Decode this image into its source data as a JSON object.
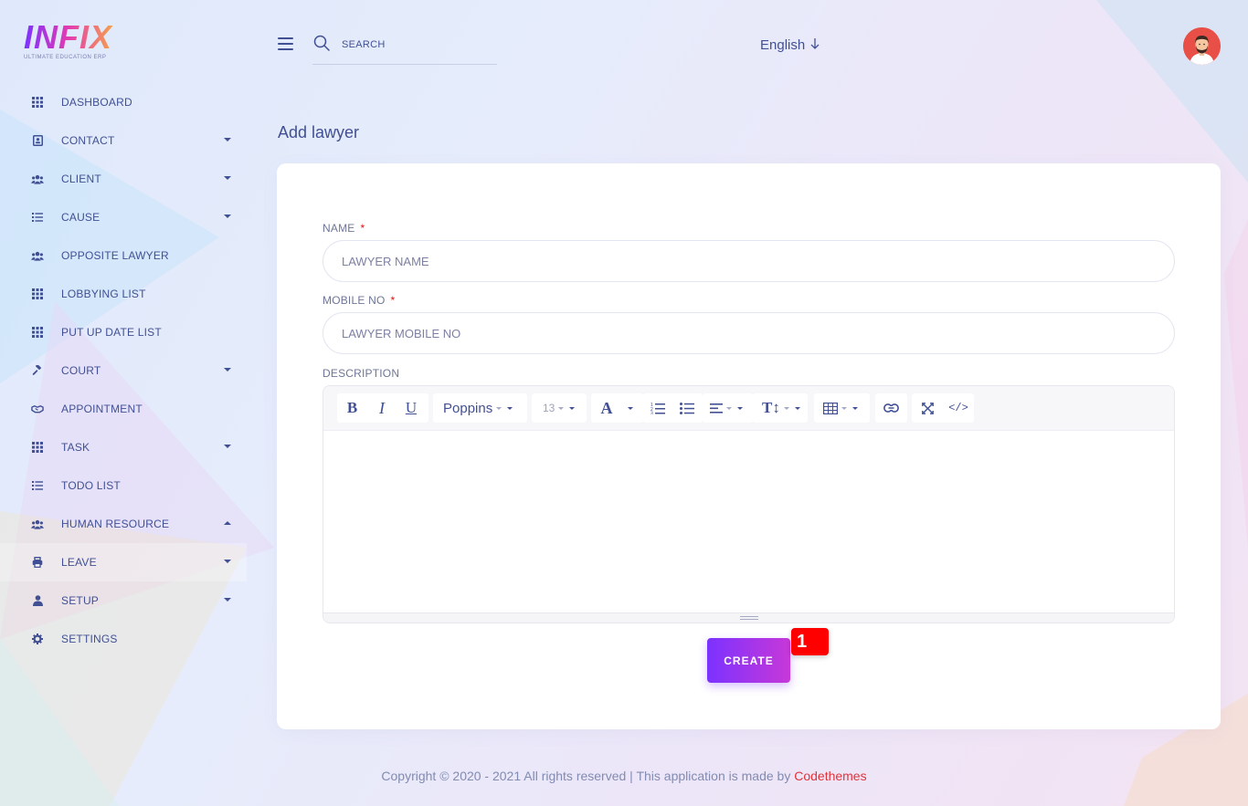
{
  "brand": {
    "logo_text": "INFIX",
    "logo_subtitle": "ULTIMATE EDUCATION ERP"
  },
  "sidebar": {
    "items": [
      {
        "label": "DASHBOARD",
        "icon": "grid-icon"
      },
      {
        "label": "CONTACT",
        "icon": "contact-book-icon"
      },
      {
        "label": "CLIENT",
        "icon": "users-icon"
      },
      {
        "label": "CAUSE",
        "icon": "list-icon"
      },
      {
        "label": "OPPOSITE LAWYER",
        "icon": "users-icon"
      },
      {
        "label": "LOBBYING LIST",
        "icon": "grid-icon"
      },
      {
        "label": "PUT UP DATE LIST",
        "icon": "grid-icon"
      },
      {
        "label": "COURT",
        "icon": "gavel-icon"
      },
      {
        "label": "APPOINTMENT",
        "icon": "handshake-icon"
      },
      {
        "label": "TASK",
        "icon": "grid-icon"
      },
      {
        "label": "TODO LIST",
        "icon": "list-icon"
      },
      {
        "label": "HUMAN RESOURCE",
        "icon": "users-icon"
      },
      {
        "label": "LEAVE",
        "icon": "printer-icon"
      },
      {
        "label": "SETUP",
        "icon": "user-icon"
      },
      {
        "label": "SETTINGS",
        "icon": "gear-icon"
      }
    ]
  },
  "header": {
    "search_placeholder": "SEARCH",
    "language": "English"
  },
  "main": {
    "title": "Add lawyer",
    "form": {
      "name_label": "NAME",
      "name_placeholder": "LAWYER NAME",
      "mobile_label": "MOBILE NO",
      "mobile_placeholder": "LAWYER MOBILE NO",
      "required_mark": "*",
      "description_label": "DESCRIPTION",
      "editor": {
        "font_family": "Poppins",
        "font_size": "13"
      },
      "create_label": "CREATE"
    },
    "badge": "1"
  },
  "footer": {
    "text": "Copyright © 2020 - 2021 All rights reserved | This application is made by ",
    "link": "Codethemes"
  },
  "colors": {
    "accent": "#7c32ff",
    "accent2": "#c738d8",
    "text": "#415094",
    "link": "#e2333b",
    "badge": "#ff0000"
  }
}
